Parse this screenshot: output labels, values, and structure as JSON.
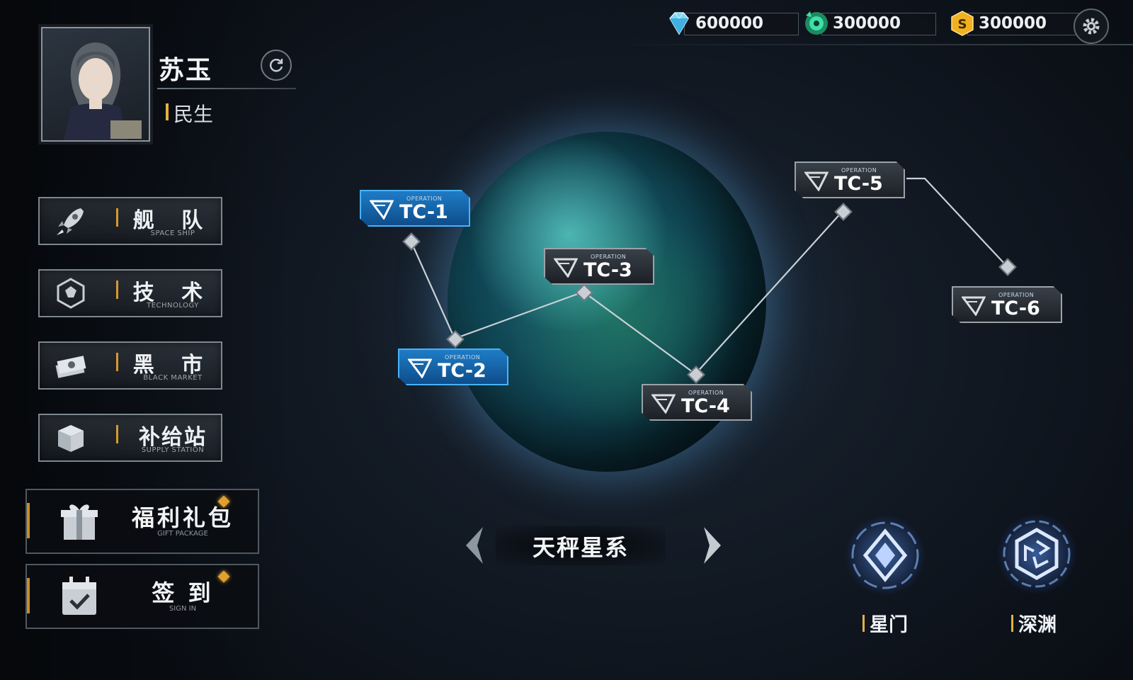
{
  "player": {
    "name": "苏玉",
    "faction": "民生"
  },
  "resources": {
    "diamond": "600000",
    "green_token": "300000",
    "coin": "300000"
  },
  "menu": [
    {
      "cn": "舰 队",
      "en": "SPACE SHIP"
    },
    {
      "cn": "技 术",
      "en": "TECHNOLOGY"
    },
    {
      "cn": "黑 市",
      "en": "BLACK MARKET"
    },
    {
      "cn": "补给站",
      "en": "SUPPLY STATION"
    }
  ],
  "gift": {
    "cn": "福利礼包",
    "en": "GIFT PACKAGE"
  },
  "signin": {
    "cn": "签 到",
    "en": "SIGN IN"
  },
  "stages": [
    {
      "op": "OPERATION",
      "code": "TC-1"
    },
    {
      "op": "OPERATION",
      "code": "TC-2"
    },
    {
      "op": "OPERATION",
      "code": "TC-3"
    },
    {
      "op": "OPERATION",
      "code": "TC-4"
    },
    {
      "op": "OPERATION",
      "code": "TC-5"
    },
    {
      "op": "OPERATION",
      "code": "TC-6"
    }
  ],
  "galaxy": {
    "name": "天秤星系"
  },
  "portals": [
    {
      "label": "星门"
    },
    {
      "label": "深渊"
    }
  ],
  "colors": {
    "accent": "#e3b040",
    "stage_active": "#1e7cc7"
  },
  "icons": [
    "diamond-icon",
    "green-token-icon",
    "coin-icon",
    "settings-icon",
    "refresh-icon",
    "rocket-icon",
    "tech-icon",
    "money-icon",
    "supply-box-icon",
    "gift-icon",
    "calendar-check-icon",
    "stargate-icon",
    "abyss-icon"
  ]
}
